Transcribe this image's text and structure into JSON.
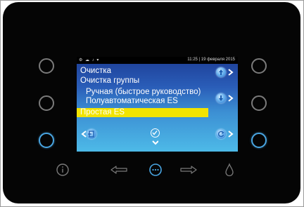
{
  "status": {
    "icons": "⚙ ☁ ♪ ▾",
    "datetime": "11:25 | 19 февраля 2015"
  },
  "menu": {
    "title": "Очистка",
    "subtitle": "Очистка группы",
    "items": [
      {
        "label": "Ручная (быстрое руководство)"
      },
      {
        "label": "Полуавтоматическая ES"
      },
      {
        "label": "Простая ES",
        "selected": true
      }
    ]
  },
  "colors": {
    "accent": "#49a6e3",
    "highlight": "#f2e400",
    "bezel": "#050505"
  },
  "icons": {
    "left_side": [
      "ring-button",
      "ring-button",
      "ring-button-active"
    ],
    "right_side": [
      "ring-button",
      "ring-button",
      "ring-button-active"
    ],
    "bottom": [
      "info-icon",
      "arrow-left-icon",
      "more-icon",
      "arrow-right-icon",
      "drop-icon"
    ]
  }
}
